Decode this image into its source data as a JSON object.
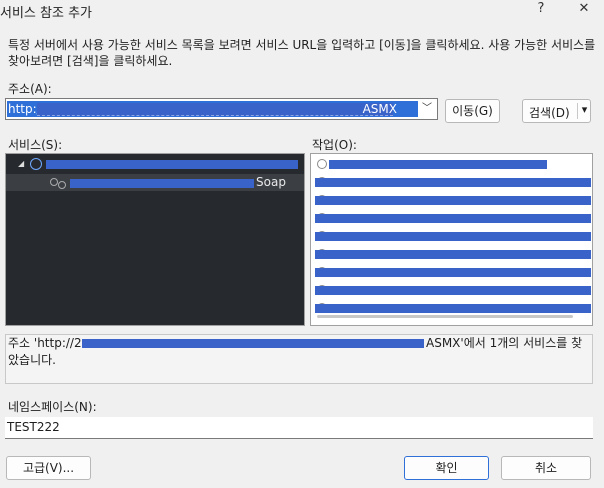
{
  "window": {
    "title": "서비스 참조 추가",
    "help_glyph": "?",
    "close_glyph": "✕"
  },
  "description": "특정 서버에서 사용 가능한 서비스 목록을 보려면 서비스 URL을 입력하고 [이동]을 클릭하세요. 사용 가능한 서비스를 찾아보려면 [검색]을 클릭하세요.",
  "address": {
    "label": "주소(A):",
    "value_prefix": "http://",
    "value_suffix": "ASMX",
    "go_button": "이동(G)",
    "discover_button": "검색(D)",
    "dropdown_glyph": "▾"
  },
  "services": {
    "label": "서비스(S):",
    "child_suffix": "Soap"
  },
  "operations": {
    "label": "작업(O):",
    "row_count": 9
  },
  "status": {
    "prefix": "주소 'http://2",
    "suffix": "ASMX'에서 1개의 서비스를 찾",
    "line2": "았습니다."
  },
  "namespace": {
    "label": "네임스페이스(N):",
    "value": "TEST222"
  },
  "buttons": {
    "advanced": "고급(V)...",
    "ok": "확인",
    "cancel": "취소"
  },
  "colors": {
    "redaction": "#3a63c9",
    "selection": "#2f6fd8",
    "tree_bg": "#262a2e"
  }
}
